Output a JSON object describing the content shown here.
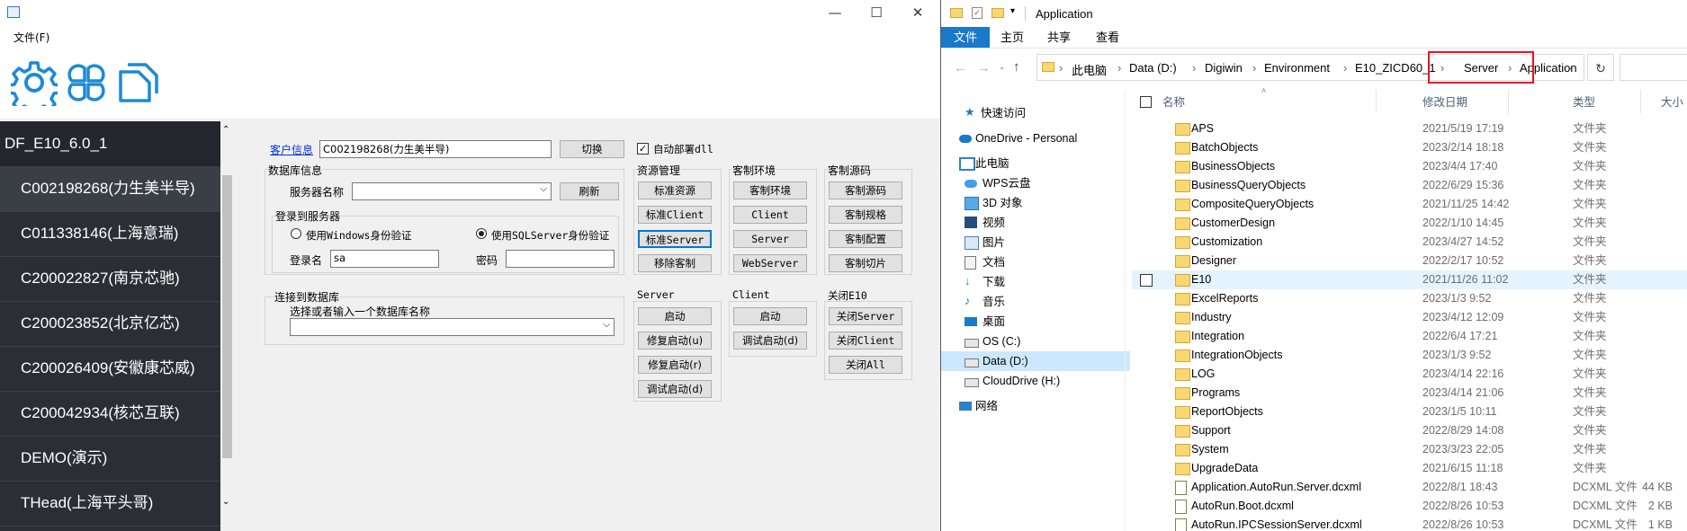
{
  "left_window": {
    "app_icon": "app-icon",
    "controls": {
      "minimize": "—",
      "maximize": "☐",
      "close": "✕"
    },
    "menu": {
      "file": "文件(F)"
    },
    "toolbar_icons": [
      "gear-icon",
      "clover-icon",
      "document-icon"
    ],
    "sidebar": {
      "header": "DF_E10_6.0_1",
      "items": [
        "C002198268(力生美半导)",
        "C011338146(上海意瑞)",
        "C200022827(南京芯驰)",
        "C200023852(北京亿芯)",
        "C200026409(安徽康芯威)",
        "C200042934(核芯互联)",
        "DEMO(演示)",
        "THead(上海平头哥)"
      ]
    },
    "customer": {
      "link": "客户信息",
      "value": "C002198268(力生美半导)",
      "switch_button": "切换",
      "auto_deploy_label": "自动部署dll",
      "auto_deploy_checked": true
    },
    "db_info": {
      "title": "数据库信息",
      "server_label": "服务器名称",
      "server_value": "",
      "refresh_button": "刷新",
      "login_title": "登录到服务器",
      "windows_auth": "使用Windows身份验证",
      "sql_auth": "使用SQLServer身份验证",
      "sql_auth_selected": true,
      "user_label": "登录名",
      "user_value": "sa",
      "password_label": "密码",
      "password_value": ""
    },
    "connect_db": {
      "title": "连接到数据库",
      "prompt": "选择或者输入一个数据库名称",
      "value": ""
    },
    "resource_mgmt": {
      "title": "资源管理",
      "buttons": [
        "标准资源",
        "标准Client",
        "标准Server",
        "移除客制"
      ]
    },
    "custom_env": {
      "title": "客制环境",
      "buttons": [
        "客制环境",
        "Client",
        "Server",
        "WebServer"
      ]
    },
    "custom_source": {
      "title": "客制源码",
      "buttons": [
        "客制源码",
        "客制规格",
        "客制配置",
        "客制切片"
      ]
    },
    "server_group": {
      "title": "Server",
      "buttons": [
        "启动",
        "修复启动(u)",
        "修复启动(r)",
        "调试启动(d)"
      ]
    },
    "client_group": {
      "title": "Client",
      "buttons": [
        "启动",
        "调试启动(d)"
      ]
    },
    "close_group": {
      "title": "关闭E10",
      "buttons": [
        "关闭Server",
        "关闭Client",
        "关闭All"
      ]
    }
  },
  "explorer": {
    "title": "Application",
    "tabs": [
      "文件",
      "主页",
      "共享",
      "查看"
    ],
    "breadcrumb": [
      "此电脑",
      "Data (D:)",
      "Digiwin",
      "Environment",
      "E10_ZICD60_1",
      "Server",
      "Application"
    ],
    "highlight_color": "#e81123",
    "accent_color": "#1979ca",
    "nav": [
      {
        "label": "快速访问",
        "icon": "star-icon"
      },
      {
        "label": "OneDrive - Personal",
        "icon": "cloud-icon"
      },
      {
        "label": "此电脑",
        "icon": "computer-icon"
      },
      {
        "label": "WPS云盘",
        "icon": "cloud-icon"
      },
      {
        "label": "3D 对象",
        "icon": "cube-icon"
      },
      {
        "label": "视频",
        "icon": "video-icon"
      },
      {
        "label": "图片",
        "icon": "picture-icon"
      },
      {
        "label": "文档",
        "icon": "document-icon"
      },
      {
        "label": "下载",
        "icon": "download-icon"
      },
      {
        "label": "音乐",
        "icon": "music-icon"
      },
      {
        "label": "桌面",
        "icon": "desktop-icon"
      },
      {
        "label": "OS (C:)",
        "icon": "drive-icon"
      },
      {
        "label": "Data (D:)",
        "icon": "drive-icon"
      },
      {
        "label": "CloudDrive (H:)",
        "icon": "drive-icon"
      },
      {
        "label": "网络",
        "icon": "network-icon"
      }
    ],
    "columns": {
      "name": "名称",
      "date": "修改日期",
      "type": "类型",
      "size": "大小"
    },
    "files": [
      {
        "name": "APS",
        "date": "2021/5/19 17:19",
        "type": "文件夹",
        "size": ""
      },
      {
        "name": "BatchObjects",
        "date": "2023/2/14 18:18",
        "type": "文件夹",
        "size": ""
      },
      {
        "name": "BusinessObjects",
        "date": "2023/4/4 17:40",
        "type": "文件夹",
        "size": ""
      },
      {
        "name": "BusinessQueryObjects",
        "date": "2022/6/29 15:36",
        "type": "文件夹",
        "size": ""
      },
      {
        "name": "CompositeQueryObjects",
        "date": "2021/11/25 14:42",
        "type": "文件夹",
        "size": ""
      },
      {
        "name": "CustomerDesign",
        "date": "2022/1/10 14:45",
        "type": "文件夹",
        "size": ""
      },
      {
        "name": "Customization",
        "date": "2023/4/27 14:52",
        "type": "文件夹",
        "size": ""
      },
      {
        "name": "Designer",
        "date": "2022/2/17 10:52",
        "type": "文件夹",
        "size": ""
      },
      {
        "name": "E10",
        "date": "2021/11/26 11:02",
        "type": "文件夹",
        "size": ""
      },
      {
        "name": "ExcelReports",
        "date": "2023/1/3 9:52",
        "type": "文件夹",
        "size": ""
      },
      {
        "name": "Industry",
        "date": "2023/4/12 12:09",
        "type": "文件夹",
        "size": ""
      },
      {
        "name": "Integration",
        "date": "2022/6/4 17:21",
        "type": "文件夹",
        "size": ""
      },
      {
        "name": "IntegrationObjects",
        "date": "2023/1/3 9:52",
        "type": "文件夹",
        "size": ""
      },
      {
        "name": "LOG",
        "date": "2023/4/14 22:16",
        "type": "文件夹",
        "size": ""
      },
      {
        "name": "Programs",
        "date": "2023/4/14 21:06",
        "type": "文件夹",
        "size": ""
      },
      {
        "name": "ReportObjects",
        "date": "2023/1/5 10:11",
        "type": "文件夹",
        "size": ""
      },
      {
        "name": "Support",
        "date": "2022/8/29 14:08",
        "type": "文件夹",
        "size": ""
      },
      {
        "name": "System",
        "date": "2023/3/23 22:05",
        "type": "文件夹",
        "size": ""
      },
      {
        "name": "UpgradeData",
        "date": "2021/6/15 11:18",
        "type": "文件夹",
        "size": ""
      },
      {
        "name": "Application.AutoRun.Server.dcxml",
        "date": "2022/8/1 18:43",
        "type": "DCXML 文件",
        "size": "44 KB"
      },
      {
        "name": "AutoRun.Boot.dcxml",
        "date": "2022/8/26 10:53",
        "type": "DCXML 文件",
        "size": "2 KB"
      },
      {
        "name": "AutoRun.IPCSessionServer.dcxml",
        "date": "2022/8/26 10:53",
        "type": "DCXML 文件",
        "size": "1 KB"
      }
    ]
  }
}
